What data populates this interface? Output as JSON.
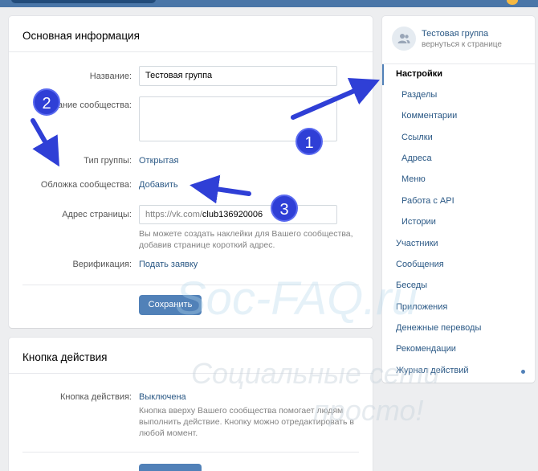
{
  "main": {
    "title": "Основная информация",
    "fields": {
      "name_label": "Название:",
      "name_value": "Тестовая группа",
      "desc_label": "ание сообщества:",
      "group_type_label": "Тип группы:",
      "group_type_value": "Открытая",
      "cover_label": "Обложка сообщества:",
      "cover_value": "Добавить",
      "address_label": "Адрес страницы:",
      "address_prefix": "https://vk.com/",
      "address_value": "club136920006",
      "address_hint": "Вы можете создать наклейки для Вашего сообщества, добавив странице короткий адрес.",
      "verification_label": "Верификация:",
      "verification_value": "Подать заявку"
    },
    "save_label": "Сохранить"
  },
  "action": {
    "title": "Кнопка действия",
    "label": "Кнопка действия:",
    "value": "Выключена",
    "hint": "Кнопка вверху Вашего сообщества помогает людям выполнить действие. Кнопку можно отредактировать в любой момент."
  },
  "sidebar": {
    "group_name": "Тестовая группа",
    "back_label": "вернуться к странице",
    "items": [
      {
        "label": "Настройки"
      },
      {
        "label": "Разделы"
      },
      {
        "label": "Комментарии"
      },
      {
        "label": "Ссылки"
      },
      {
        "label": "Адреса"
      },
      {
        "label": "Меню"
      },
      {
        "label": "Работа с API"
      },
      {
        "label": "Истории"
      },
      {
        "label": "Участники"
      },
      {
        "label": "Сообщения"
      },
      {
        "label": "Беседы"
      },
      {
        "label": "Приложения"
      },
      {
        "label": "Денежные переводы"
      },
      {
        "label": "Рекомендации"
      },
      {
        "label": "Журнал действий"
      }
    ]
  },
  "annotations": {
    "one": "1",
    "two": "2",
    "three": "3"
  },
  "watermark": {
    "line1": "Soc-FAQ.ru",
    "line2": "Социальные сети",
    "line3": "просто!"
  },
  "colors": {
    "accent": "#5181b8",
    "link": "#2a5885",
    "annotation": "#2f3fd6"
  }
}
